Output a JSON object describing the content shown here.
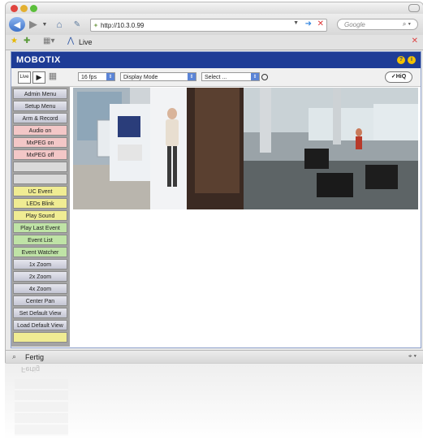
{
  "browser": {
    "url": "http://10.3.0.99",
    "search_placeholder": "Google",
    "tab_title": "Live",
    "status_text": "Fertig",
    "reflection_text": "Fertig"
  },
  "app": {
    "logo": "MOBOTIX",
    "header_icons": [
      "?",
      "i"
    ],
    "controls": {
      "view_single": "Live",
      "fps": "16 fps",
      "display_mode": "Display Mode",
      "select": "Select ...",
      "hiq": "✓HiQ"
    },
    "sidebar": [
      {
        "label": "Admin Menu",
        "style": "gray"
      },
      {
        "label": "Setup Menu",
        "style": "gray"
      },
      {
        "label": "Arm & Record",
        "style": "gray"
      },
      {
        "label": "Audio on",
        "style": "red"
      },
      {
        "label": "MxPEG on",
        "style": "red"
      },
      {
        "label": "MxPEG off",
        "style": "red"
      },
      {
        "label": "",
        "style": "blank"
      },
      {
        "label": "",
        "style": "blank"
      },
      {
        "label": "UC Event",
        "style": "yel"
      },
      {
        "label": "LEDs Blink",
        "style": "yel"
      },
      {
        "label": "Play Sound",
        "style": "yel"
      },
      {
        "label": "Play Last Event",
        "style": "grn"
      },
      {
        "label": "Event List",
        "style": "grn"
      },
      {
        "label": "Event Watcher",
        "style": "grn"
      },
      {
        "label": "1x Zoom",
        "style": "gray"
      },
      {
        "label": "2x Zoom",
        "style": "gray"
      },
      {
        "label": "4x Zoom",
        "style": "gray"
      },
      {
        "label": "Center Pan",
        "style": "gray"
      },
      {
        "label": "Set Default View",
        "style": "gray"
      },
      {
        "label": "Load Default View",
        "style": "gray"
      },
      {
        "label": "",
        "style": "yel"
      }
    ]
  }
}
